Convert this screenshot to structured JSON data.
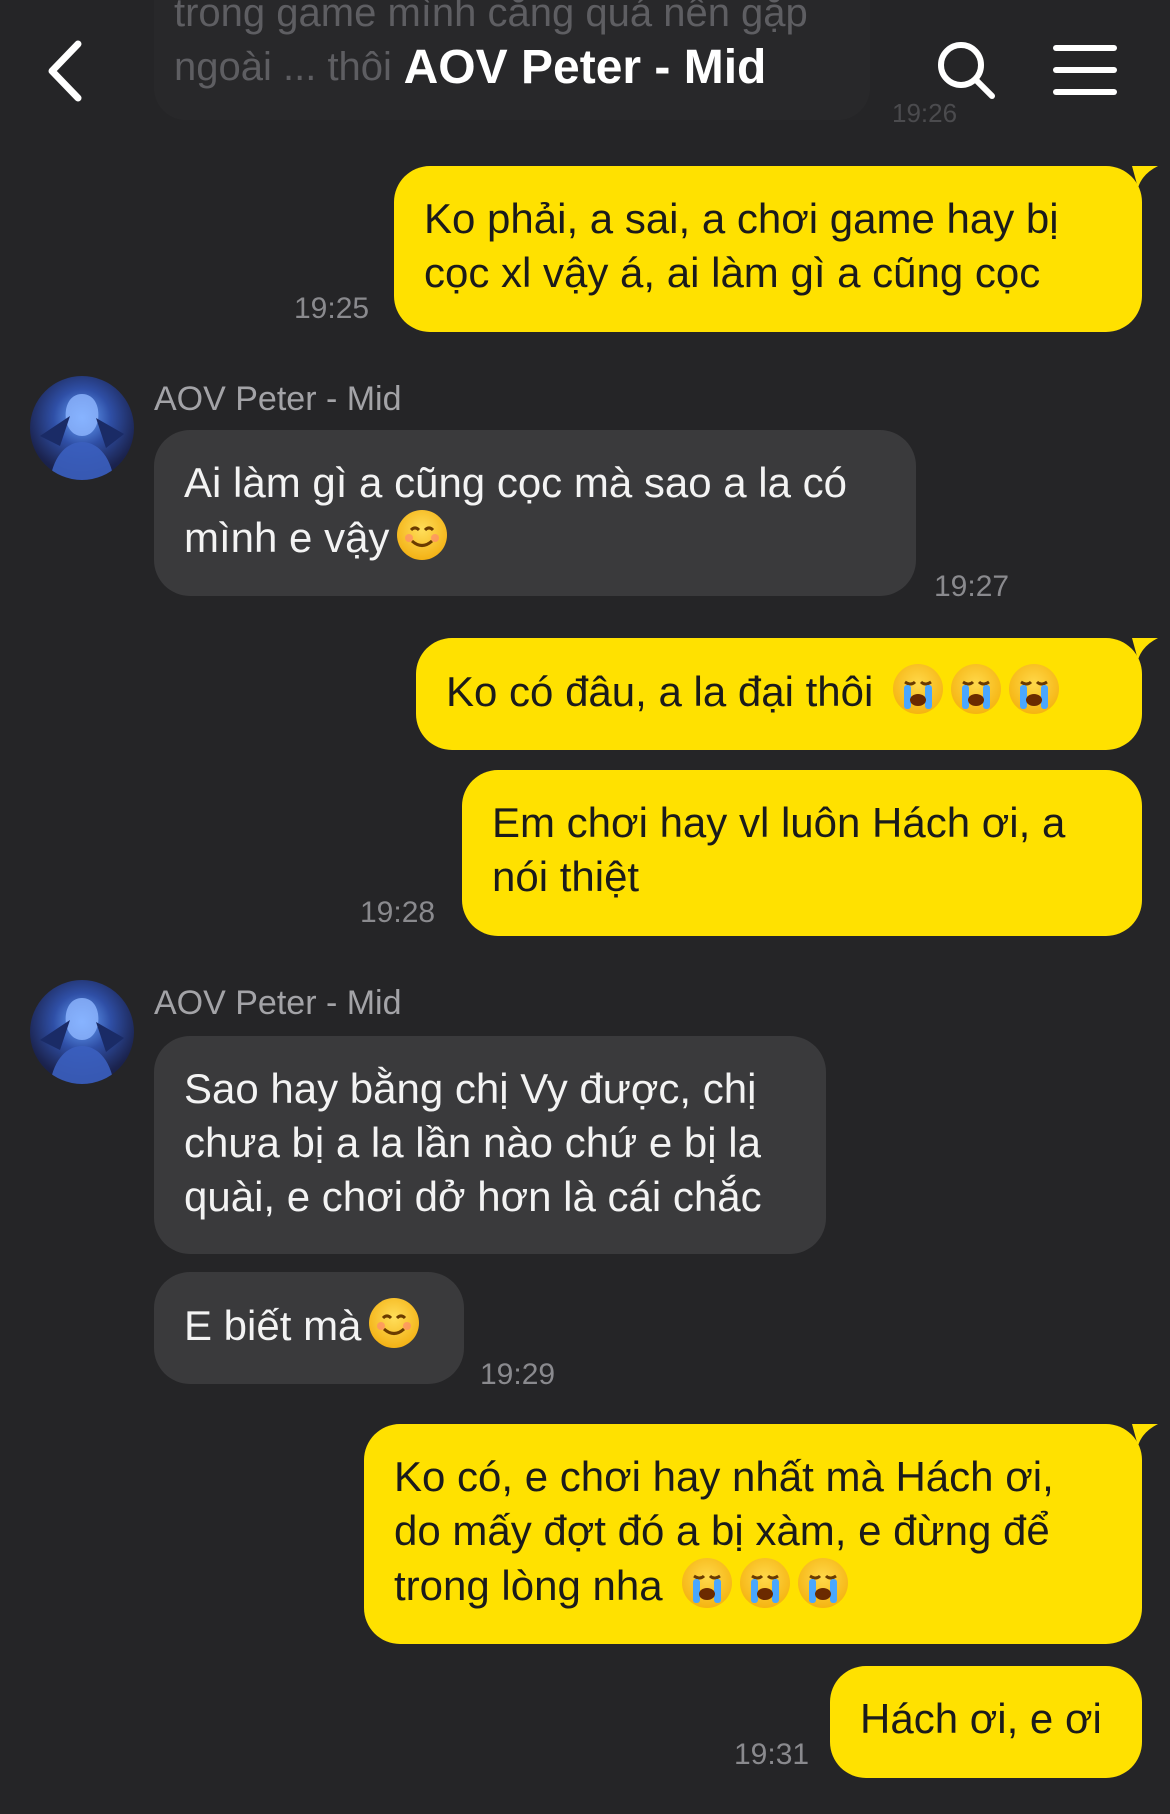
{
  "header": {
    "title": "AOV Peter - Mid",
    "back_icon": "chevron-left-icon",
    "search_icon": "search-icon",
    "menu_icon": "hamburger-menu-icon"
  },
  "previous_message": {
    "text": "trong game mình căng quá nên gặp ngoài ... thôi",
    "time": "19:26"
  },
  "messages": [
    {
      "direction": "out",
      "text": "Ko phải, a sai, a chơi game hay bị cọc xl vậy á, ai làm gì a cũng cọc",
      "time": "19:25"
    },
    {
      "direction": "in",
      "sender": "AOV Peter - Mid",
      "text": "Ai làm gì a cũng cọc mà sao a la có mình e vậy",
      "emoji": "☺️",
      "time": "19:27"
    },
    {
      "direction": "out",
      "text": "Ko có đâu, a la đại thôi",
      "emoji": "😭😭😭"
    },
    {
      "direction": "out",
      "text": "Em chơi hay vl luôn Hách ơi, a nói thiệt",
      "time": "19:28"
    },
    {
      "direction": "in",
      "sender": "AOV Peter - Mid",
      "text": "Sao hay bằng chị Vy được, chị chưa bị a la lần nào chứ e bị la quài, e chơi dở hơn là cái chắc"
    },
    {
      "direction": "in",
      "text": "E biết mà",
      "emoji": "☺️",
      "time": "19:29"
    },
    {
      "direction": "out",
      "text": "Ko có, e chơi hay nhất mà Hách ơi, do mấy đợt đó a bị xàm, e đừng để trong lòng nha",
      "emoji": "😭😭😭"
    },
    {
      "direction": "out",
      "text": "Hách ơi, e ơi",
      "time": "19:31"
    }
  ],
  "colors": {
    "background": "#252527",
    "outgoing_bubble": "#ffe100",
    "incoming_bubble": "#3a3a3c",
    "timestamp": "#8a8a8e"
  }
}
